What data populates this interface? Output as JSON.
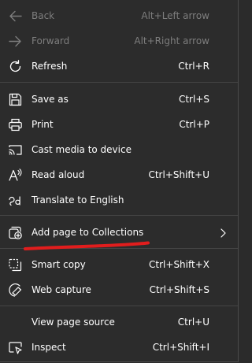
{
  "menu": {
    "items": [
      {
        "label": "Back",
        "shortcut": "Alt+Left arrow",
        "icon": "arrow-left-icon",
        "disabled": true
      },
      {
        "label": "Forward",
        "shortcut": "Alt+Right arrow",
        "icon": "arrow-right-icon",
        "disabled": true
      },
      {
        "label": "Refresh",
        "shortcut": "Ctrl+R",
        "icon": "refresh-icon",
        "disabled": false
      },
      {
        "label": "Save as",
        "shortcut": "Ctrl+S",
        "icon": "save-icon",
        "disabled": false
      },
      {
        "label": "Print",
        "shortcut": "Ctrl+P",
        "icon": "print-icon",
        "disabled": false
      },
      {
        "label": "Cast media to device",
        "shortcut": "",
        "icon": "cast-icon",
        "disabled": false
      },
      {
        "label": "Read aloud",
        "shortcut": "Ctrl+Shift+U",
        "icon": "read-aloud-icon",
        "disabled": false
      },
      {
        "label": "Translate to English",
        "shortcut": "",
        "icon": "translate-icon",
        "disabled": false
      },
      {
        "label": "Add page to Collections",
        "shortcut": "",
        "icon": "collections-add-icon",
        "disabled": false,
        "submenu": true
      },
      {
        "label": "Smart copy",
        "shortcut": "Ctrl+Shift+X",
        "icon": "smart-copy-icon",
        "disabled": false
      },
      {
        "label": "Web capture",
        "shortcut": "Ctrl+Shift+S",
        "icon": "web-capture-icon",
        "disabled": false
      },
      {
        "label": "View page source",
        "shortcut": "Ctrl+U",
        "icon": "",
        "disabled": false
      },
      {
        "label": "Inspect",
        "shortcut": "Ctrl+Shift+I",
        "icon": "inspect-icon",
        "disabled": false
      }
    ]
  },
  "colors": {
    "background": "#2c2c2c",
    "text": "#ffffff",
    "disabled_text": "#7d7d7d",
    "separator": "#454545",
    "annotation": "#e11d1d"
  }
}
